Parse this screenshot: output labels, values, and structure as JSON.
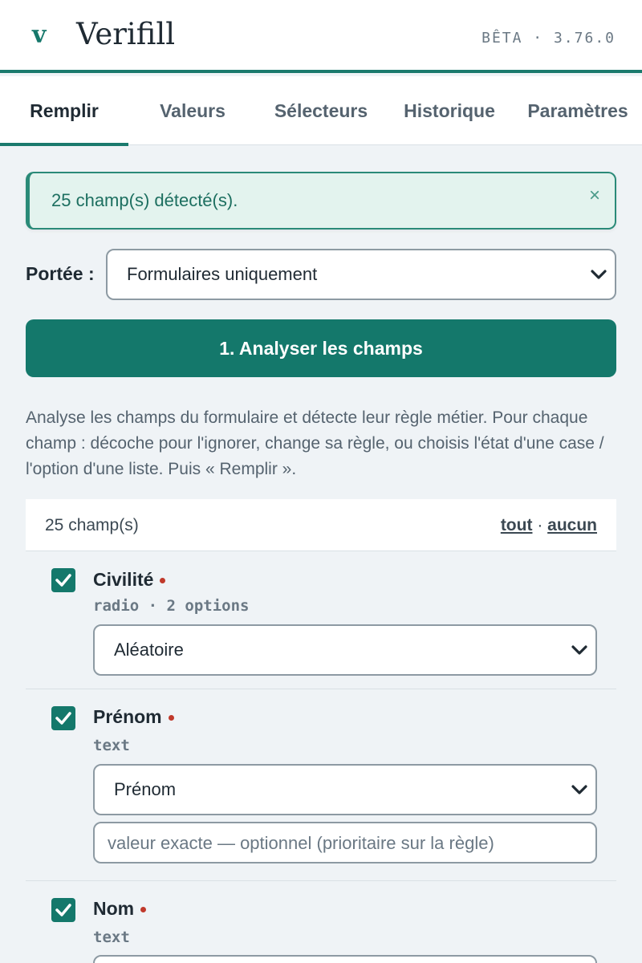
{
  "header": {
    "logo": "v",
    "title": "Verifill",
    "version": "BÊTA · 3.76.0"
  },
  "tabs": [
    {
      "label": "Remplir",
      "active": true
    },
    {
      "label": "Valeurs",
      "active": false
    },
    {
      "label": "Sélecteurs",
      "active": false
    },
    {
      "label": "Historique",
      "active": false
    },
    {
      "label": "Paramètres",
      "active": false
    }
  ],
  "alert": {
    "text": "25 champ(s) détecté(s).",
    "close": "×"
  },
  "scope": {
    "label": "Portée :",
    "value": "Formulaires uniquement"
  },
  "analyze_button": "1. Analyser les champs",
  "help": "Analyse les champs du formulaire et détecte leur règle métier. Pour chaque champ : décoche pour l'ignorer, change sa règle, ou choisis l'état d'une case / l'option d'une liste. Puis « Remplir ».",
  "list": {
    "count": "25 champ(s)",
    "select_all": "tout",
    "separator": "·",
    "select_none": "aucun"
  },
  "fields": [
    {
      "name": "Civilité",
      "type": "radio · 2 options",
      "rule": "Aléatoire",
      "checked": true,
      "required": true
    },
    {
      "name": "Prénom",
      "type": "text",
      "rule": "Prénom",
      "value_placeholder": "valeur exacte — optionnel (prioritaire sur la règle)",
      "checked": true,
      "required": true
    },
    {
      "name": "Nom",
      "type": "text",
      "checked": true,
      "required": true
    }
  ],
  "colors": {
    "accent": "#14786b",
    "alert_bg": "#e3f3ee",
    "required_dot": "#c0392b"
  }
}
